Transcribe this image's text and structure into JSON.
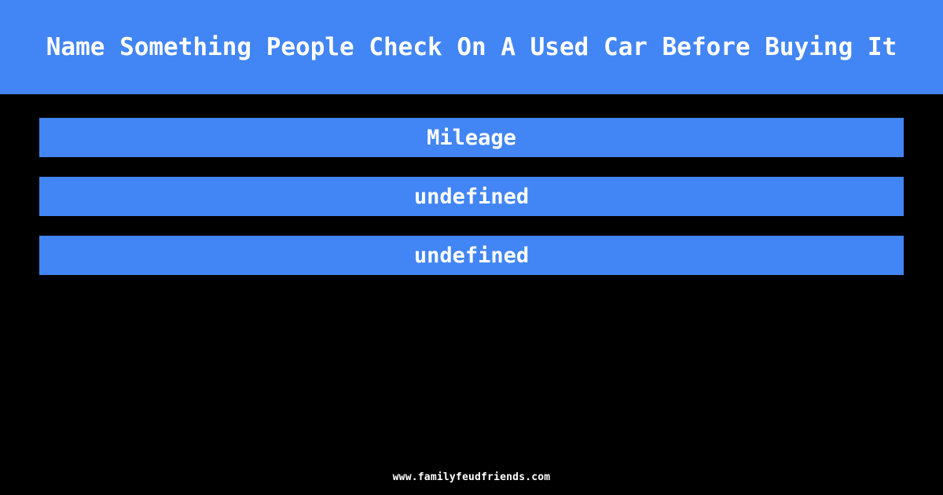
{
  "theme": {
    "background_color": "#000000",
    "accent_color": "#4285f4",
    "text_color": "#ffffff"
  },
  "header": {
    "question": "Name Something People Check On A Used Car Before Buying It"
  },
  "answers": {
    "items": [
      {
        "label": "Mileage"
      },
      {
        "label": "undefined"
      },
      {
        "label": "undefined"
      }
    ]
  },
  "footer": {
    "url": "www.familyfeudfriends.com"
  }
}
